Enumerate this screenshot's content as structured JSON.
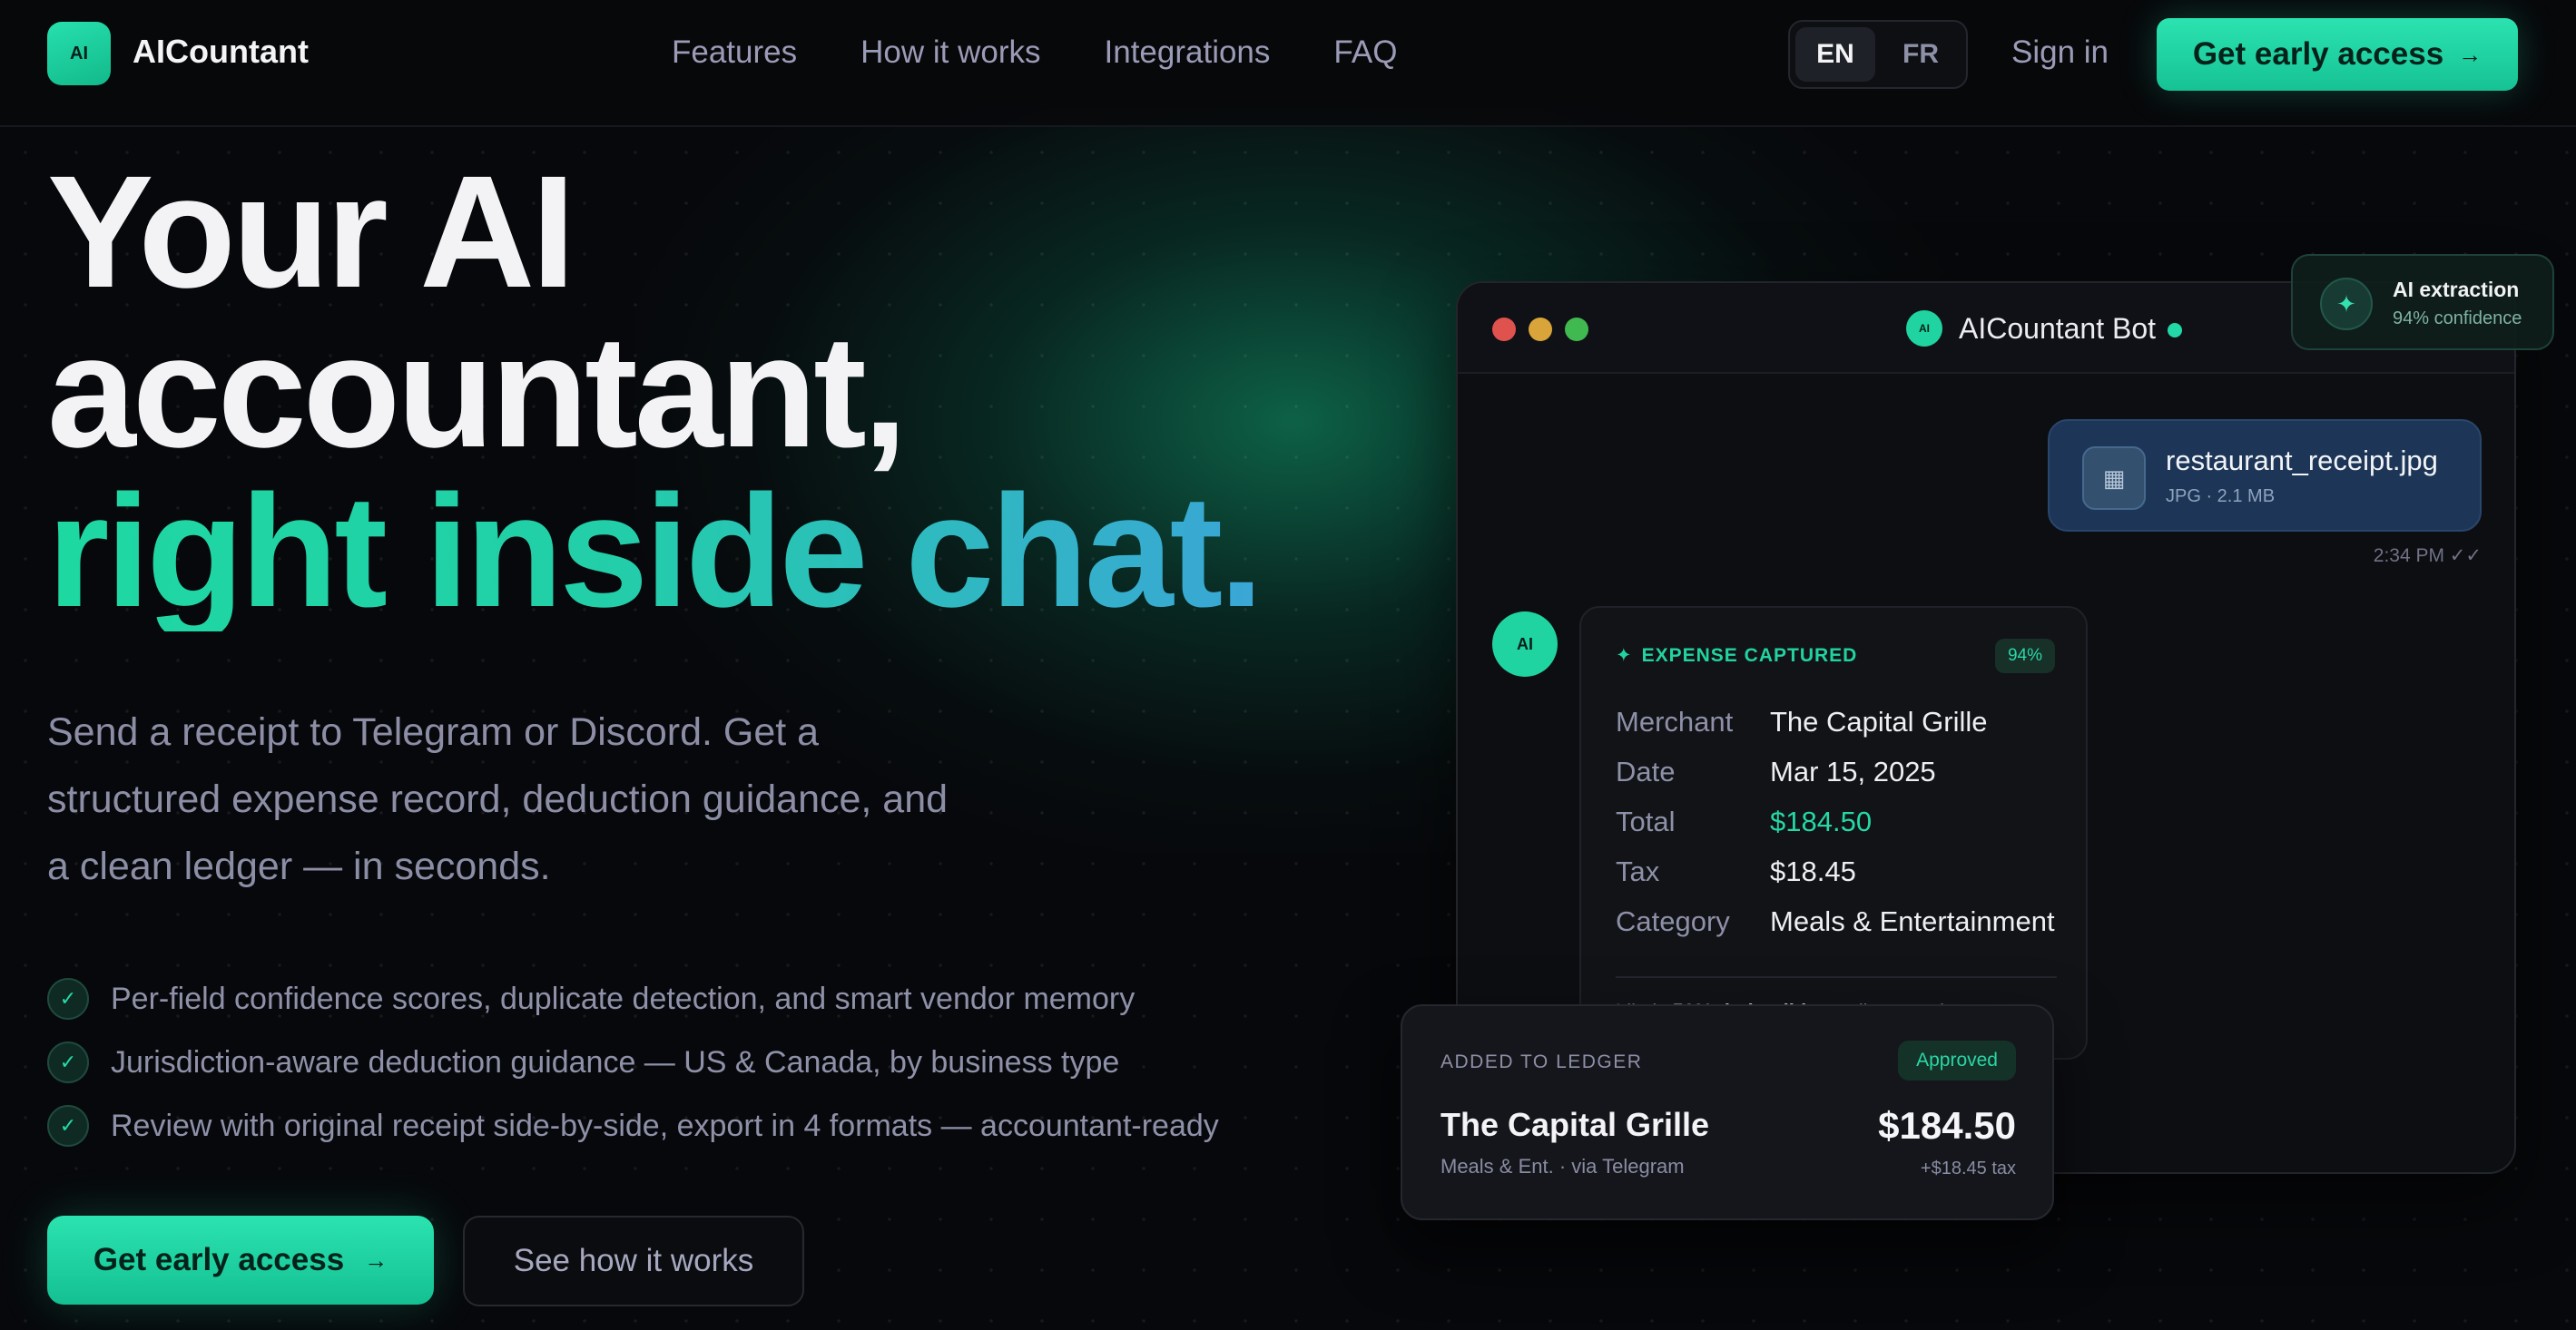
{
  "nav": {
    "logo_text": "AI",
    "brand": "AICountant",
    "links": [
      "Features",
      "How it works",
      "Integrations",
      "FAQ"
    ],
    "lang": {
      "en": "EN",
      "fr": "FR",
      "active": "EN"
    },
    "signin": "Sign in",
    "cta": "Get early access",
    "arrow": "→"
  },
  "hero": {
    "line1": "Your AI",
    "line2": "accountant,",
    "line3": "right inside chat.",
    "subtitle": "Send a receipt to Telegram or Discord. Get a structured expense record, deduction guidance, and a clean ledger — in seconds.",
    "features": [
      "Per-field confidence scores, duplicate detection, and smart vendor memory",
      "Jurisdiction-aware deduction guidance — US & Canada, by business type",
      "Review with original receipt side-by-side, export in 4 formats — accountant-ready"
    ],
    "cta_primary": "Get early access",
    "cta_secondary": "See how it works"
  },
  "chat": {
    "bot_avatar": "AI",
    "bot_name": "AICountant Bot",
    "file": {
      "name": "restaurant_receipt.jpg",
      "meta": "JPG · 2.1 MB",
      "time": "2:34 PM ✓✓"
    },
    "expense": {
      "header": "EXPENSE CAPTURED",
      "confidence": "94%",
      "rows": [
        {
          "key": "Merchant",
          "value": "The Capital Grille"
        },
        {
          "key": "Date",
          "value": "Mar 15, 2025"
        },
        {
          "key": "Total",
          "value": "$184.50"
        },
        {
          "key": "Tax",
          "value": "$18.45"
        },
        {
          "key": "Category",
          "value": "Meals & Entertainment"
        }
      ],
      "note_prefix": "Likely",
      "note_bold": "50% deductible",
      "note_suffix": "— client meal"
    }
  },
  "ledger": {
    "label": "ADDED TO LEDGER",
    "status": "Approved",
    "merchant": "The Capital Grille",
    "meta": "Meals & Ent. · via Telegram",
    "amount": "$184.50",
    "tax": "+$18.45 tax"
  },
  "extraction": {
    "title": "AI extraction",
    "subtitle": "94% confidence"
  },
  "colors": {
    "accent": "#1fd4a0",
    "background": "#07080b",
    "traffic_red": "#e0524d",
    "traffic_yellow": "#d9a43a",
    "traffic_green": "#3fb950"
  }
}
